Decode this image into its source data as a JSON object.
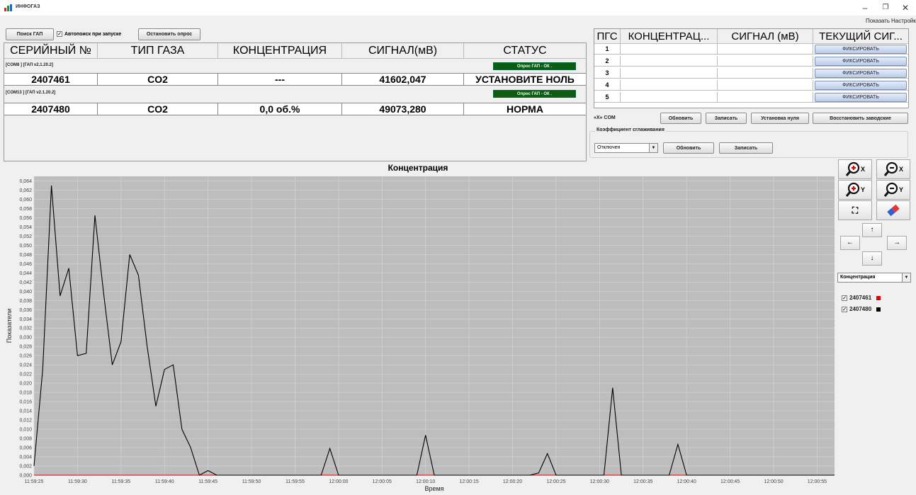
{
  "window": {
    "title": "ИНФОГАЗ",
    "minimize": "–",
    "maximize": "❐",
    "close": "✕"
  },
  "menu": {
    "show": "Показать",
    "settings": "Настройки"
  },
  "toolbar": {
    "search": "Поиск ГАП",
    "autosearch_checked": true,
    "autosearch": "Автопоиск при запуске",
    "stop": "Остановить опрос"
  },
  "main_table": {
    "headers": [
      "СЕРИЙНЫЙ №",
      "ТИП ГАЗА",
      "КОНЦЕНТРАЦИЯ",
      "СИГНАЛ(мВ)",
      "СТАТУС"
    ],
    "groups": [
      {
        "label": "[COM8 ] [ГАП v2.1.20.2]",
        "poll_status": "Опрос ГАП - ОК .",
        "row": {
          "serial": "2407461",
          "gas": "CO2",
          "conc": "---",
          "signal": "41602,047",
          "status": "УСТАНОВИТЕ НОЛЬ"
        }
      },
      {
        "label": "[COM13 ] [ГАП v2.1.20.2]",
        "poll_status": "Опрос ГАП - ОК .",
        "row": {
          "serial": "2407480",
          "gas": "CO2",
          "conc": "0,0 об.%",
          "signal": "49073,280",
          "status": "НОРМА"
        }
      }
    ]
  },
  "pgs_table": {
    "headers": [
      "ПГС",
      "КОНЦЕНТРАЦ...",
      "СИГНАЛ (мВ)",
      "ТЕКУЩИЙ СИГ..."
    ],
    "rows": [
      "1",
      "2",
      "3",
      "4",
      "5"
    ],
    "fix_label": "ФИКСИРОВАТЬ"
  },
  "com_controls": {
    "label": "«X» COM",
    "refresh": "Обновить",
    "write": "Записать",
    "zero": "Установка нуля",
    "restore": "Восстановить заводские"
  },
  "smoothing": {
    "title": "Коэффициент сглаживания",
    "value": "Отключен",
    "refresh": "Обновить",
    "write": "Записать"
  },
  "side_panel": {
    "zoom_in_x": "X",
    "zoom_out_x": "X",
    "zoom_in_y": "Y",
    "zoom_out_y": "Y",
    "fit": "⛶",
    "up": "↑",
    "left": "←",
    "right": "→",
    "down": "↓",
    "metric": "Концентрация",
    "legend": [
      {
        "name": "2407461",
        "checked": true,
        "color": "#e00000"
      },
      {
        "name": "2407480",
        "checked": true,
        "color": "#000000"
      }
    ]
  },
  "chart_data": {
    "type": "line",
    "title": "Концентрация",
    "xlabel": "Время",
    "ylabel": "Показатели",
    "ylim": [
      0,
      0.065
    ],
    "y_ticks": [
      "0,000",
      "0,002",
      "0,004",
      "0,006",
      "0,008",
      "0,010",
      "0,012",
      "0,014",
      "0,016",
      "0,018",
      "0,020",
      "0,022",
      "0,024",
      "0,026",
      "0,028",
      "0,030",
      "0,032",
      "0,034",
      "0,036",
      "0,038",
      "0,040",
      "0,042",
      "0,044",
      "0,046",
      "0,048",
      "0,050",
      "0,052",
      "0,054",
      "0,056",
      "0,058",
      "0,060",
      "0,062",
      "0,064"
    ],
    "x_ticks": [
      "11:59:25",
      "11:59:30",
      "11:59:35",
      "11:59:40",
      "11:59:45",
      "11:59:50",
      "11:59:55",
      "12:00:00",
      "12:00:05",
      "12:00:10",
      "12:00:15",
      "12:00:20",
      "12:00:25",
      "12:00:30",
      "12:00:35",
      "12:00:40",
      "12:00:45",
      "12:00:50",
      "12:00:55"
    ],
    "grid": true,
    "background": "#bdbdbd",
    "series": [
      {
        "name": "2407461",
        "color": "#e00000",
        "points": [
          [
            0.0,
            0.0
          ],
          [
            92.0,
            0.0
          ]
        ]
      },
      {
        "name": "2407480",
        "color": "#000000",
        "points": [
          [
            0.0,
            0.002
          ],
          [
            1.0,
            0.023
          ],
          [
            2.0,
            0.063
          ],
          [
            3.0,
            0.039
          ],
          [
            4.0,
            0.045
          ],
          [
            5.0,
            0.026
          ],
          [
            6.0,
            0.0265
          ],
          [
            7.0,
            0.0565
          ],
          [
            8.0,
            0.0395
          ],
          [
            9.0,
            0.024
          ],
          [
            10.0,
            0.029
          ],
          [
            11.0,
            0.048
          ],
          [
            12.0,
            0.0435
          ],
          [
            13.0,
            0.028
          ],
          [
            14.0,
            0.015
          ],
          [
            15.0,
            0.023
          ],
          [
            16.0,
            0.024
          ],
          [
            17.0,
            0.01
          ],
          [
            18.0,
            0.006
          ],
          [
            19.0,
            0.0
          ],
          [
            20.0,
            0.001
          ],
          [
            21.0,
            0.0
          ],
          [
            33.0,
            0.0
          ],
          [
            34.0,
            0.0058
          ],
          [
            35.0,
            0.0
          ],
          [
            44.0,
            0.0
          ],
          [
            45.0,
            0.0087
          ],
          [
            46.0,
            0.0
          ],
          [
            57.0,
            0.0
          ],
          [
            58.0,
            0.0005
          ],
          [
            59.0,
            0.0047
          ],
          [
            60.0,
            0.0
          ],
          [
            65.5,
            0.0
          ],
          [
            66.5,
            0.019
          ],
          [
            67.5,
            0.0
          ],
          [
            73.0,
            0.0
          ],
          [
            74.0,
            0.0067
          ],
          [
            75.0,
            0.0
          ],
          [
            92.0,
            0.0
          ]
        ]
      }
    ]
  }
}
